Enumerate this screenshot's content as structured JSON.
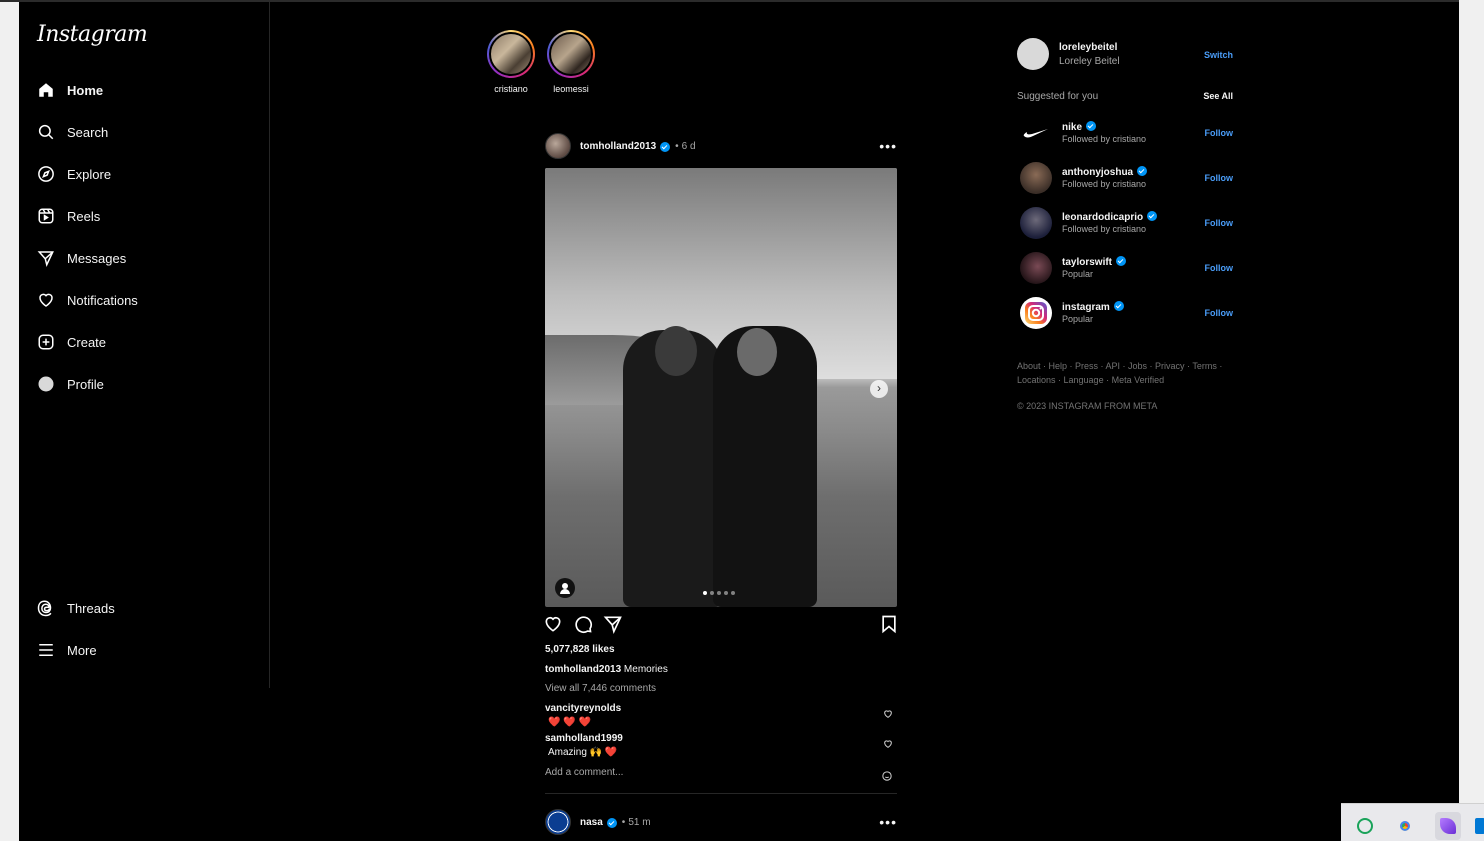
{
  "app": {
    "logo": "Instagram"
  },
  "sidebar": {
    "items": [
      {
        "label": "Home",
        "icon": "home-icon",
        "active": true
      },
      {
        "label": "Search",
        "icon": "search-icon"
      },
      {
        "label": "Explore",
        "icon": "compass-icon"
      },
      {
        "label": "Reels",
        "icon": "reels-icon"
      },
      {
        "label": "Messages",
        "icon": "paper-plane-icon"
      },
      {
        "label": "Notifications",
        "icon": "heart-icon"
      },
      {
        "label": "Create",
        "icon": "plus-square-icon"
      },
      {
        "label": "Profile",
        "icon": "profile-avatar-icon"
      }
    ],
    "bottom": [
      {
        "label": "Threads",
        "icon": "threads-icon"
      },
      {
        "label": "More",
        "icon": "hamburger-menu-icon"
      }
    ]
  },
  "stories": [
    {
      "username": "cristiano"
    },
    {
      "username": "leomessi"
    }
  ],
  "post": {
    "username": "tomholland2013",
    "time": "6 d",
    "likes": "5,077,828 likes",
    "caption_user": "tomholland2013",
    "caption_text": "Memories",
    "view_all": "View all 7,446 comments",
    "comments": [
      {
        "user": "vancityreynolds",
        "text": "❤️ ❤️ ❤️"
      },
      {
        "user": "samholland1999",
        "text": "Amazing 🙌 ❤️"
      }
    ],
    "add_comment_placeholder": "Add a comment...",
    "carousel": {
      "current": 1,
      "total": 5
    }
  },
  "next_post": {
    "username": "nasa",
    "time": "51 m"
  },
  "account": {
    "username": "loreleybeitel",
    "name": "Loreley Beitel",
    "switch_label": "Switch"
  },
  "suggestions": {
    "heading": "Suggested for you",
    "see_all": "See All",
    "follow_label": "Follow",
    "items": [
      {
        "username": "nike",
        "sub": "Followed by cristiano"
      },
      {
        "username": "anthonyjoshua",
        "sub": "Followed by cristiano"
      },
      {
        "username": "leonardodicaprio",
        "sub": "Followed by cristiano"
      },
      {
        "username": "taylorswift",
        "sub": "Popular"
      },
      {
        "username": "instagram",
        "sub": "Popular"
      }
    ]
  },
  "footer": {
    "links_line1": "About · Help · Press · API · Jobs · Privacy · Terms ·",
    "links_line2": "Locations · Language · Meta Verified",
    "copyright": "© 2023 INSTAGRAM FROM META"
  },
  "colors": {
    "accent": "#4a9df8",
    "verified": "#0095f6",
    "background": "#000000"
  }
}
